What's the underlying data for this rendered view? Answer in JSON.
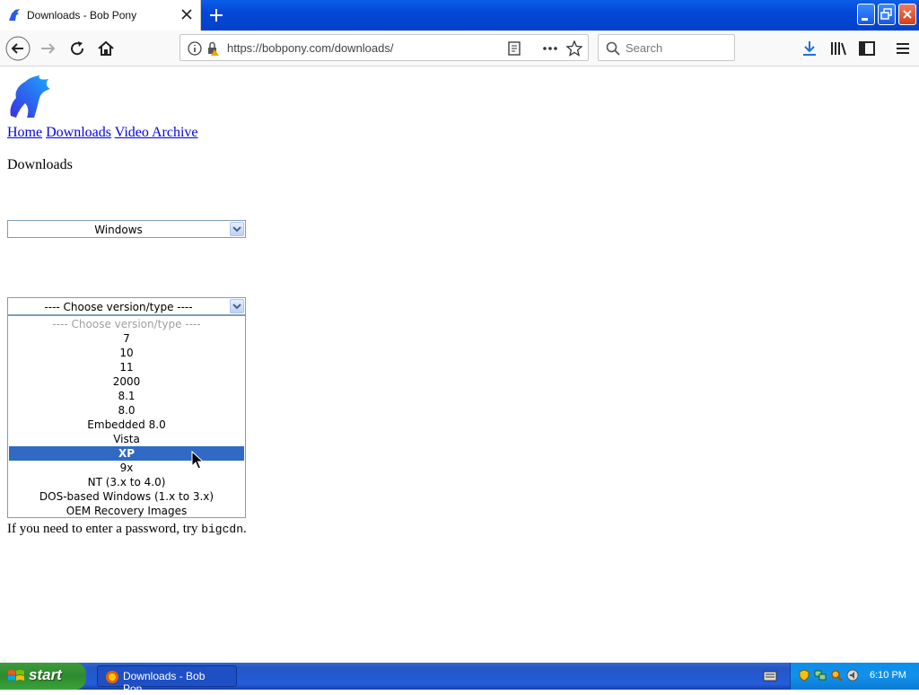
{
  "browser": {
    "tab_title": "Downloads - Bob Pony",
    "url": "https://bobpony.com/downloads/",
    "search_placeholder": "Search"
  },
  "page": {
    "nav_links": [
      "Home",
      "Downloads",
      "Video Archive"
    ],
    "heading": "Downloads",
    "os_select": {
      "value": "Windows"
    },
    "version_select": {
      "value": "---- Choose version/type ----",
      "options": [
        "---- Choose version/type ----",
        "7",
        "10",
        "11",
        "2000",
        "8.1",
        "8.0",
        "Embedded 8.0",
        "Vista",
        "XP",
        "9x",
        "NT (3.x to 4.0)",
        "DOS-based Windows (1.x to 3.x)",
        "OEM Recovery Images"
      ],
      "highlighted": "XP"
    },
    "note_prefix": "If you need to enter a password, try ",
    "note_code": "bigcdn",
    "note_suffix": "."
  },
  "taskbar": {
    "start_label": "start",
    "task_label": "Downloads - Bob Pon...",
    "clock": "6:10 PM"
  }
}
